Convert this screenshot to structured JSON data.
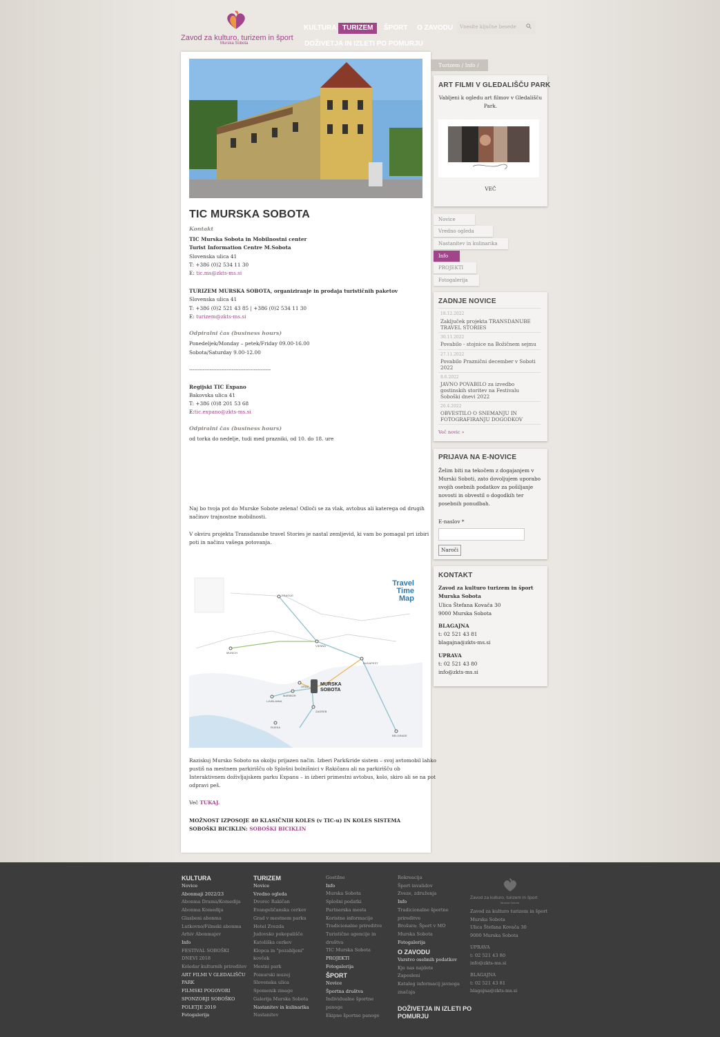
{
  "header": {
    "logo_text": "Zavod za kulturo, turizem in šport",
    "logo_sub": "Murska Sobota",
    "nav": [
      "KULTURA",
      "TURIZEM",
      "ŠPORT",
      "O ZAVODU"
    ],
    "nav_sub": "DOŽIVETJA IN IZLETI PO POMURJU",
    "search_placeholder": "Vnesite ključne besede"
  },
  "main": {
    "title": "TIC MURSKA SOBOTA",
    "kontakt_label": "Kontakt",
    "tic_name1": "TIC Murska Sobota in Mobilnostni center",
    "tic_name2": "Turist Information Centre M.Sobota",
    "tic_addr": "Slovenska ulica 41",
    "tic_tel": "T: +386 (0)2 534 11 30",
    "tic_email_prefix": "E: ",
    "tic_email": "tic.ms@zkts-ms.si",
    "tur_name": "TURIZEM MURSKA SOBOTA, organiziranje in prodaja turističnih paketov",
    "tur_addr": "Slovenska ulica 41",
    "tur_tel": "T: +386 (0)2 521 43 85 | +386 (0)2 534 11 30",
    "tur_email_prefix": "E: ",
    "tur_email": "turizem@zkts-ms.si",
    "hours_label": "Odpiralni čas (business hours)",
    "hours1": "Ponedeljek/Monday – petek/Friday  09.00-16.00",
    "hours2": "Sobota/Saturday 9.00-12.00",
    "separator": "------------------------------------------------",
    "expano_name": "Regijski TIC Expano",
    "expano_addr": "Bakovska ulica 41",
    "expano_tel": "T: +386 (0)8 201 53 68",
    "expano_email_prefix": "E:",
    "expano_email": "tic.expano@zkts-ms.si",
    "hours2_label": "Odpiralni čas (business hours)",
    "hours2_text": "od torka do nedelje, tudi med prazniki, od 10. do 18. ure",
    "para1a": "Naj bo tvoja pot do Murske Sobote zelena! Odloči se za vlak, avtobus ali katerega od drugih",
    "para1b": "načinov trajnostne mobilnosti.",
    "para2a": "V okviru projekta Transdanube travel Stories je nastal zemljevid, ki vam bo pomagal pri izbiri",
    "para2b": "poti in načinu vašega potovanja.",
    "map_title1": "Travel Time",
    "map_title2": "Map",
    "map_city": "MURSKA SOBOTA",
    "map_labels": [
      "PRAGUE",
      "VIENNA",
      "MUNICH",
      "BUDAPEST",
      "GRAZ",
      "MARIBOR",
      "LJUBLJANA",
      "ZAGREB",
      "BELGRADE",
      "RIJEKA"
    ],
    "para3a": "Raziskuj Mursko Soboto na okolju prijazen način. Izberi Park&ride sistem – svoj avtomobil lahko",
    "para3b": "pustiš na mestnem parkirišču ob Splošni bolnišnici v Rakičanu ali na parkirišču ob",
    "para3c": "Interaktivnem doživljajskem parku Expanu – in izberi primestni avtobus, kolo, skiro ali se na pot",
    "para3d": "odpravi peš.",
    "vec_prefix": "Več ",
    "vec_link": "TUKAJ.",
    "bike1": "MOŽNOST IZPOSOJE 40 KLASIČNIH KOLES (v TIC-u) IN KOLES SISTEMA",
    "bike2": "SOBOŠKI BICIKLIN: ",
    "bike_link": "SOBOŠKI BICIKLIN"
  },
  "sidebar": {
    "breadcrumb": "Turizem / Info /",
    "art": {
      "title": "ART FILMI V GLEDALIŠČU PARK",
      "text1": "Vabljeni k ogledu art filmov v Gledališču",
      "text2": "Park.",
      "more": "VEČ"
    },
    "tabs": [
      "Novice",
      "Vredno ogleda",
      "Nastanitev in kulinarika",
      "Info",
      "PROJEKTI",
      "Fotogalerija"
    ],
    "news": {
      "title": "ZADNJE NOVICE",
      "items": [
        {
          "date": "18.12.2022",
          "title1": "Zaključek projekta TRANSDANUBE",
          "title2": "TRAVEL STORIES"
        },
        {
          "date": "30.11.2022",
          "title1": "Povabilo - stojnice na Božičnem sejmu",
          "title2": ""
        },
        {
          "date": "27.11.2022",
          "title1": "Povabilo Praznični december v Soboti",
          "title2": "2022"
        },
        {
          "date": "8.6.2022",
          "title1": "JAVNO POVABILO za izvedbo",
          "title2": "gostinskih storitev na Festivalu",
          "title3": "Soboški dnevi 2022"
        },
        {
          "date": "26.4.2022",
          "title1": "OBVESTILO O SNEMANJU IN",
          "title2": "FOTOGRAFIRANJU DOGODKOV"
        }
      ],
      "more": "Več novic »"
    },
    "newsletter": {
      "title": "PRIJAVA NA E-NOVICE",
      "text": [
        "Želim biti na tekočem z dogajanjem v",
        "Murski Soboti, zato dovoljujem uporabo",
        "svojih osebnih podatkov za pošiljanje",
        "novosti in obvestil o dogodkih ter",
        "posebnih ponudbah."
      ],
      "email_label": "E-naslov *",
      "button": "Naroči"
    },
    "kontakt": {
      "title": "KONTAKT",
      "org1": "Zavod za kulturo turizem in šport",
      "org2": "Murska Sobota",
      "addr1": "Ulica Štefana Kovača 30",
      "addr2": "9000 Murska Sobota",
      "blag_label": "BLAGAJNA",
      "blag_tel": "t: 02 521 43 81",
      "blag_email": "blagajna@zkts-ms.si",
      "upr_label": "UPRAVA",
      "upr_tel": "t: 02 521 43 80",
      "upr_email": "info@zkts-ms.si"
    }
  },
  "footer": {
    "col1": {
      "title": "KULTURA",
      "items": [
        "Novice",
        "Abonmaji 2022/23",
        "Abonma Drama/Komedija",
        "Abonma Komedija",
        "Glasbeni abonma",
        "Lutkovno/Filmski abonma",
        "Arhiv Abonmajev",
        "Info",
        "FESTIVAL SOBOŠKI",
        "DNEVI 2018",
        "Koledar kulturnih prireditev",
        "ART FILMI V GLEDALIŠČU",
        "PARK",
        "FILMSKI POGOVORI",
        "SPONZORJI SOBOŠKO",
        "POLETJE 2019",
        "Fotogalerija"
      ]
    },
    "col2": {
      "title": "TURIZEM",
      "items": [
        "Novice",
        "Vredno ogleda",
        "Dvorec Rakičan",
        "Evangeličanska cerkev",
        "Grad v mestnem parku",
        "Hotel Zvezda",
        "Judovsko pokopališče",
        "Katoliška cerkev",
        "Klopca in \"pozabljeni\"",
        "kovček",
        "Mestni park",
        "Pomurski muzej",
        "Slovenska ulica",
        "Spomenik zmage",
        "Galerija Murska Sobota",
        "Nastanitev in kulinarika",
        "Nastanitev"
      ]
    },
    "col3": {
      "items": [
        "Gostilne",
        "Info",
        "Murska Sobota",
        "Splošni podatki",
        "Partnerska mesta",
        "Koristne informacije",
        "Tradicionalne prireditve",
        "Turistične agencije in",
        "društva",
        "TIC Murska Sobota",
        "PROJEKTI",
        "Fotogalerija"
      ],
      "sport_title": "ŠPORT",
      "sport_items": [
        "Novice",
        "Športna društva",
        "Individualne športne",
        "panoge",
        "Ekipne športne panoge"
      ]
    },
    "col4": {
      "items": [
        "Rekreacija",
        "Šport invalidov",
        "Zveze, združenja",
        "Info",
        "Tradicionalne športne",
        "prireditve",
        "Brošura: Šport v MO",
        "Murska Sobota",
        "Fotogalerija"
      ],
      "zavod_title": "O ZAVODU",
      "zavod_items": [
        "Varstvo osebnih podatkov",
        "Kje nas najdete",
        "Zaposleni",
        "Katalog informacij javnega",
        "značaja"
      ],
      "dozivetja_title1": "DOŽIVETJA IN IZLETI PO",
      "dozivetja_title2": "POMURJU"
    },
    "col5": {
      "logo_text": "Zavod za kulturo, turizem in šport",
      "logo_sub": "Murska Sobota",
      "lines": [
        "Zavod za kulturo turizem in šport",
        "Murska Sobota",
        "Ulica Štefana Kovača 30",
        "9000 Murska Sobota"
      ],
      "upr_label": "UPRAVA",
      "upr": [
        "t: 02 521 43 80",
        "info@zkts-ms.si"
      ],
      "blag_label": "BLAGAJNA",
      "blag": [
        "t: 02 521 43 81",
        "blagajna@zkts-ms.si"
      ]
    }
  },
  "colors": {
    "accent": "#a0458a",
    "footer_bg": "#3c3c3c",
    "page_bg": "#e5e2dc"
  }
}
